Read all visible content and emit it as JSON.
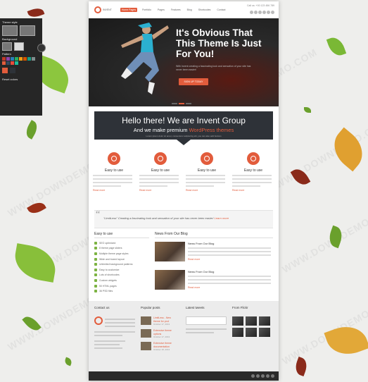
{
  "style_panel": {
    "title": "Theme style",
    "background_label": "Background",
    "pattern_label": "Pattern",
    "swatches": [
      "#c0392b",
      "#8e44ad",
      "#2980b9",
      "#27ae60",
      "#f39c12",
      "#d35400",
      "#16a085",
      "#7f8c8d",
      "#e25c3c",
      "#34495e",
      "#e74c3c",
      "#1abc9c"
    ],
    "footer_label": "Reset colors"
  },
  "header": {
    "logo_text": "INVENT",
    "nav": [
      "Home Pages",
      "Portfolio",
      "Pages",
      "Features",
      "Blog",
      "Shortcodes",
      "Contact"
    ],
    "contact_line": "Call us: +00 123 456 789"
  },
  "hero": {
    "headline": "It's Obvious That This Theme Is Just For You!",
    "subtext": "With Invent creating a fascinating look and sensation of your site has never been easier!",
    "button": "SIGN UP TODAY"
  },
  "intro": {
    "title": "Hello there! We are Invent Group",
    "subtitle_prefix": "And we make premium ",
    "subtitle_highlight": "WordPress themes",
    "small": "Lorem ipsum dolor sit amet, consectetur adipiscing elit, you can also add buttons"
  },
  "features": [
    {
      "title": "Easy to use",
      "read_more": "Read more"
    },
    {
      "title": "Easy to use",
      "read_more": "Read more"
    },
    {
      "title": "Easy to use",
      "read_more": "Read more"
    },
    {
      "title": "Easy to use",
      "read_more": "Read more"
    }
  ],
  "quote": {
    "text": "\"LimitLess\" Creating a fascinating look and sensation of your site has never been easier! ",
    "link": "Learn more"
  },
  "easy": {
    "title": "Easy to use",
    "items": [
      "SEO optimized",
      "8 theme page sliders",
      "Multiple theme page styles",
      "Wide and boxed layout",
      "Unlimited background patterns",
      "Easy to customize",
      "Lots of shortcodes",
      "Custom widgets",
      "50 HTML pages",
      "36 PSD files"
    ]
  },
  "news": {
    "title": "News From Our Blog",
    "posts": [
      {
        "title": "News From Our Blog",
        "read_more": "Read more"
      },
      {
        "title": "News From Our Blog",
        "read_more": "Read more"
      }
    ]
  },
  "footer": {
    "contact_title": "Contact us",
    "popular_title": "Popular posts",
    "tweets_title": "Latest tweets",
    "flickr_title": "From Flickr",
    "popular_posts": [
      {
        "title": "LimitLess - New theme for you!",
        "date": "October 17, 2013"
      },
      {
        "title": "Extensive theme options",
        "date": "October 17, 2013"
      },
      {
        "title": "Extensive theme documentation",
        "date": "October 18, 2013"
      }
    ]
  },
  "watermark": "WWW.DOWNDEMO.COM"
}
